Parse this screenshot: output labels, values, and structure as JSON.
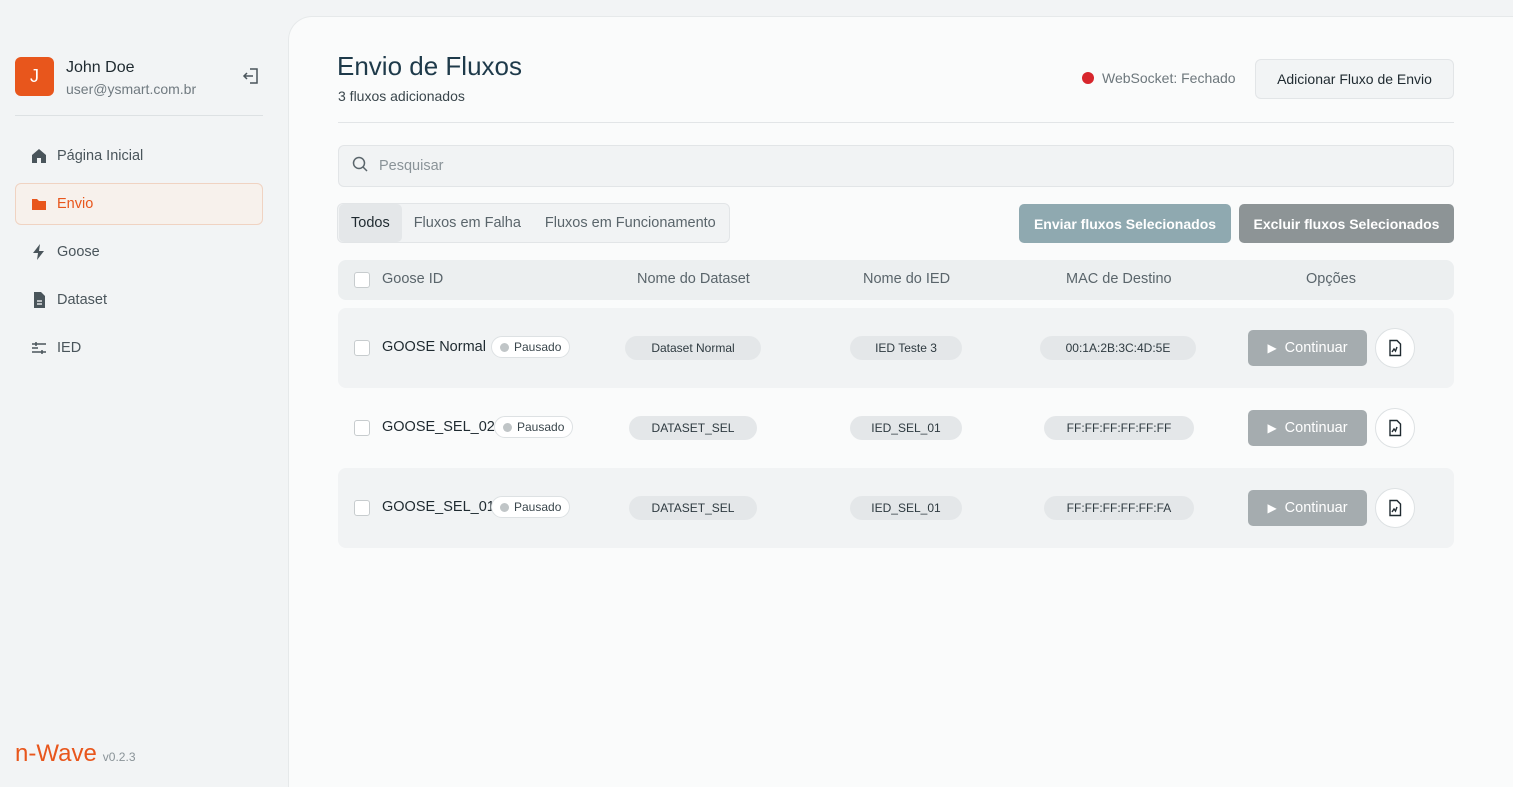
{
  "user": {
    "initial": "J",
    "name": "John Doe",
    "email": "user@ysmart.com.br"
  },
  "nav": [
    {
      "label": "Página Inicial",
      "icon": "home-icon"
    },
    {
      "label": "Envio",
      "icon": "folder-icon",
      "active": true
    },
    {
      "label": "Goose",
      "icon": "bolt-icon"
    },
    {
      "label": "Dataset",
      "icon": "file-icon"
    },
    {
      "label": "IED",
      "icon": "sliders-icon"
    }
  ],
  "brand": {
    "name": "n-Wave",
    "version": "v0.2.3"
  },
  "header": {
    "title": "Envio de Fluxos",
    "subtitle": "3 fluxos adicionados",
    "websocket_status": "WebSocket: Fechado",
    "add_button": "Adicionar Fluxo de Envio"
  },
  "search": {
    "placeholder": "Pesquisar",
    "value": ""
  },
  "tabs": [
    "Todos",
    "Fluxos em Falha",
    "Fluxos em Funcionamento"
  ],
  "actions": {
    "send_selected": "Enviar fluxos Selecionados",
    "delete_selected": "Excluir fluxos Selecionados"
  },
  "columns": [
    "Goose ID",
    "Nome do Dataset",
    "Nome do IED",
    "MAC de Destino",
    "Opções"
  ],
  "rows": [
    {
      "goose_id": "GOOSE Normal",
      "status": "Pausado",
      "dataset": "Dataset Normal",
      "ied": "IED Teste 3",
      "mac": "00:1A:2B:3C:4D:5E",
      "action": "Continuar"
    },
    {
      "goose_id": "GOOSE_SEL_02",
      "status": "Pausado",
      "dataset": "DATASET_SEL",
      "ied": "IED_SEL_01",
      "mac": "FF:FF:FF:FF:FF:FF",
      "action": "Continuar"
    },
    {
      "goose_id": "GOOSE_SEL_01",
      "status": "Pausado",
      "dataset": "DATASET_SEL",
      "ied": "IED_SEL_01",
      "mac": "FF:FF:FF:FF:FF:FA",
      "action": "Continuar"
    }
  ],
  "colors": {
    "accent": "#e8561c",
    "ws_closed": "#d7262c",
    "send_button": "#8fa9b0",
    "delete_button": "#8d9496"
  }
}
